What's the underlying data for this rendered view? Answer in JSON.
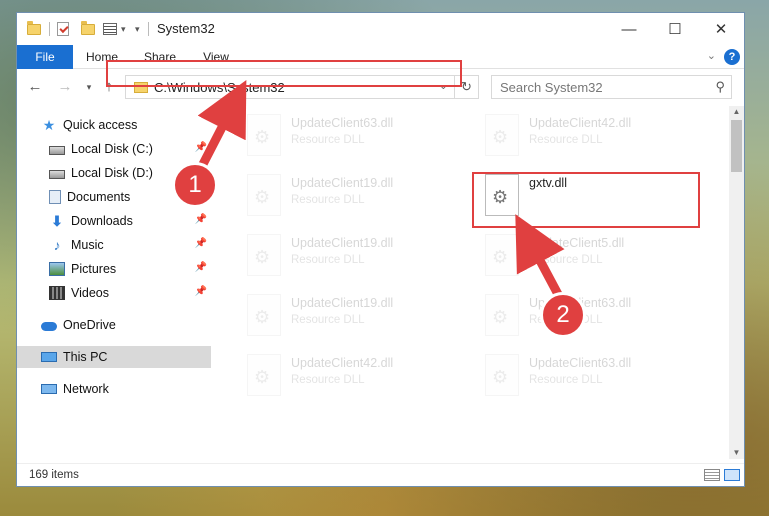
{
  "window": {
    "title": "System32",
    "controls": {
      "minimize": "—",
      "maximize": "☐",
      "close": "✕"
    }
  },
  "ribbon": {
    "tabs": [
      "File",
      "Home",
      "Share",
      "View"
    ],
    "help": "?"
  },
  "address": {
    "path": "C:\\Windows\\System32",
    "search_placeholder": "Search System32"
  },
  "nav": {
    "items": [
      {
        "label": "Quick access",
        "icon": "star-icon",
        "pinned": false
      },
      {
        "label": "Local Disk (C:)",
        "icon": "drive-icon",
        "pinned": true
      },
      {
        "label": "Local Disk (D:)",
        "icon": "drive-icon",
        "pinned": false
      },
      {
        "label": "Documents",
        "icon": "documents-icon",
        "pinned": true
      },
      {
        "label": "Downloads",
        "icon": "downloads-icon",
        "pinned": true
      },
      {
        "label": "Music",
        "icon": "music-icon",
        "pinned": true
      },
      {
        "label": "Pictures",
        "icon": "pictures-icon",
        "pinned": true
      },
      {
        "label": "Videos",
        "icon": "videos-icon",
        "pinned": true
      },
      {
        "label": "OneDrive",
        "icon": "onedrive-icon",
        "pinned": false
      },
      {
        "label": "This PC",
        "icon": "this-pc-icon",
        "pinned": false,
        "selected": true
      },
      {
        "label": "Network",
        "icon": "network-icon",
        "pinned": false
      }
    ]
  },
  "files": {
    "left_column": [
      {
        "name": "UpdateClient63.dll",
        "desc": "Resource DLL"
      },
      {
        "name": "UpdateClient19.dll",
        "desc": "Resource DLL"
      },
      {
        "name": "UpdateClient19.dll",
        "desc": "Resource DLL"
      },
      {
        "name": "UpdateClient19.dll",
        "desc": "Resource DLL"
      },
      {
        "name": "UpdateClient42.dll",
        "desc": "Resource DLL"
      }
    ],
    "right_column": [
      {
        "name": "UpdateClient42.dll",
        "desc": "Resource DLL"
      },
      {
        "name": "gxtv.dll",
        "desc": ""
      },
      {
        "name": "UpdateClient5.dll",
        "desc": "Resource DLL"
      },
      {
        "name": "UpdateClient63.dll",
        "desc": "Resource DLL"
      },
      {
        "name": "UpdateClient63.dll",
        "desc": "Resource DLL"
      }
    ]
  },
  "status": {
    "item_count": "169 items"
  },
  "callouts": {
    "step1": "1",
    "step2": "2"
  },
  "colors": {
    "accent": "#1a6fd1",
    "highlight": "#e04040",
    "selected_nav": "#d9d9d9"
  }
}
